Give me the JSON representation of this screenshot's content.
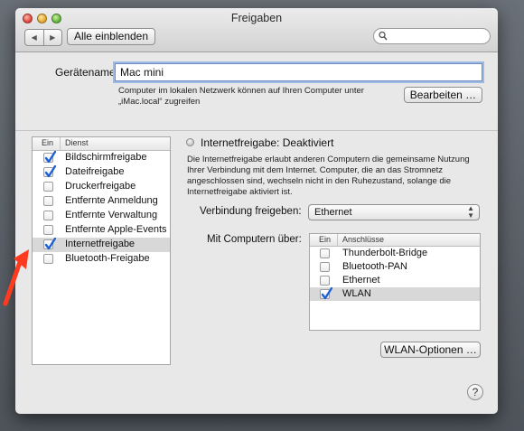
{
  "window": {
    "title": "Freigaben"
  },
  "toolbar": {
    "back_icon": "◀",
    "forward_icon": "▶",
    "show_all_label": "Alle einblenden",
    "search_value": ""
  },
  "computer_name": {
    "label": "Gerätename:",
    "value": "Mac mini",
    "info_line1": "Computer im lokalen Netzwerk können auf Ihren Computer unter",
    "info_line2": "„iMac.local“ zugreifen",
    "edit_button": "Bearbeiten …"
  },
  "services": {
    "header_on": "Ein",
    "header_service": "Dienst",
    "items": [
      {
        "label": "Bildschirmfreigabe",
        "checked": true
      },
      {
        "label": "Dateifreigabe",
        "checked": true
      },
      {
        "label": "Druckerfreigabe",
        "checked": false
      },
      {
        "label": "Entfernte Anmeldung",
        "checked": false
      },
      {
        "label": "Entfernte Verwaltung",
        "checked": false
      },
      {
        "label": "Entfernte Apple-Events",
        "checked": false
      },
      {
        "label": "Internetfreigabe",
        "checked": true,
        "selected": true
      },
      {
        "label": "Bluetooth-Freigabe",
        "checked": false
      }
    ]
  },
  "detail": {
    "status": "Internetfreigabe: Deaktiviert",
    "description": [
      "Die Internetfreigabe erlaubt anderen Computern die gemeinsame Nutzung",
      "Ihrer Verbindung mit dem Internet. Computer, die an das Stromnetz",
      "angeschlossen sind, wechseln nicht in den Ruhezustand, solange die",
      "Internetfreigabe aktiviert ist."
    ],
    "share_label": "Verbindung freigeben:",
    "share_value": "Ethernet",
    "popup_arrows": "▴▾",
    "computers_label": "Mit Computern über:",
    "ports_header_on": "Ein",
    "ports_header_name": "Anschlüsse",
    "ports": [
      {
        "label": "Thunderbolt-Bridge",
        "checked": false
      },
      {
        "label": "Bluetooth-PAN",
        "checked": false
      },
      {
        "label": "Ethernet",
        "checked": false
      },
      {
        "label": "WLAN",
        "checked": true,
        "selected": true
      }
    ],
    "wlan_options_button": "WLAN-Optionen …"
  },
  "help_button": "?",
  "colors": {
    "accent_check": "#1a5fd6",
    "annotation_arrow": "#ff3b1f",
    "selection": "#d8d8d8"
  }
}
